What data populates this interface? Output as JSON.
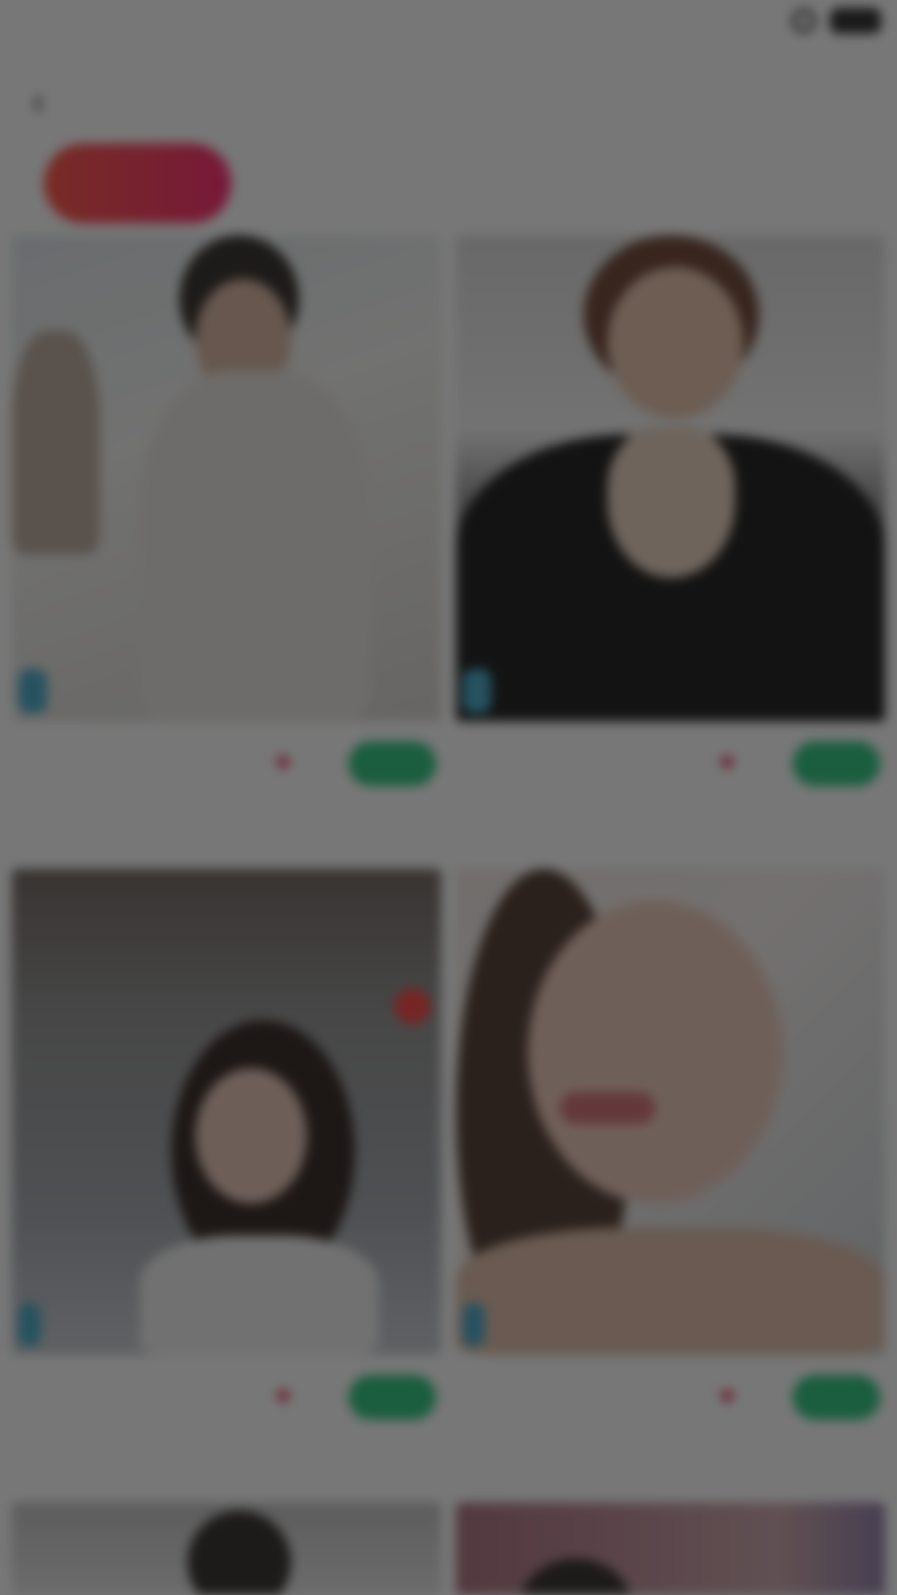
{
  "statusbar": {
    "carrier": "",
    "time": "",
    "battery": ""
  },
  "nav": {
    "back_icon": "chevron-left-icon",
    "title": ""
  },
  "tabs": [
    {
      "label": "",
      "active": true
    },
    {
      "label": ""
    },
    {
      "label": ""
    },
    {
      "label": ""
    }
  ],
  "cards": [
    {
      "badge": "",
      "meta_left": "",
      "cta": "",
      "caption": ""
    },
    {
      "badge": "",
      "meta_left": "",
      "cta": "",
      "caption": ""
    },
    {
      "badge": "",
      "meta_left": "",
      "cta": "",
      "caption": ""
    },
    {
      "badge": "",
      "meta_left": "",
      "cta": "",
      "caption": ""
    }
  ],
  "colors": {
    "accent_gradient_start": "#ff4d3d",
    "accent_gradient_end": "#ff1f6b",
    "cta_green": "#23c27a",
    "badge_blue": "#3ea7c8",
    "overlay": "rgba(20,20,20,0.58)"
  }
}
